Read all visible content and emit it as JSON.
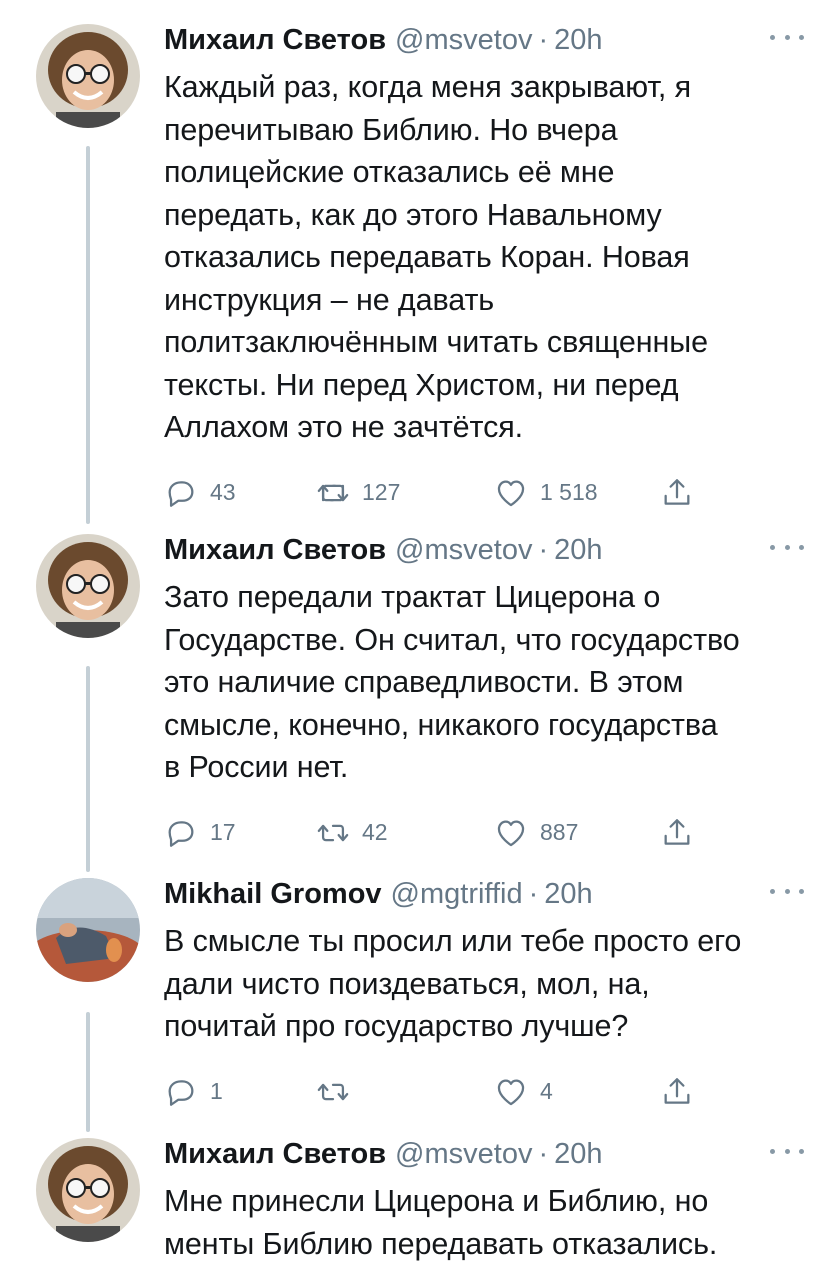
{
  "tweets": [
    {
      "name": "Михаил Светов",
      "handle": "@msvetov",
      "separator": "·",
      "time": "20h",
      "text": "Каждый раз, когда меня закрывают, я\nперечитываю Библию. Но вчера\nполицейские отказались её мне\nпередать, как до этого Навальному\nотказались передавать Коран. Новая\nинструкция – не давать\nполитзаключённым читать священные\nтексты. Ни перед Христом, ни перед\nАллахом это не зачтётся.",
      "replies": "43",
      "retweets": "127",
      "likes": "1 518"
    },
    {
      "name": "Михаил Светов",
      "handle": "@msvetov",
      "separator": "·",
      "time": "20h",
      "text": "Зато передали трактат Цицерона о\nГосударстве. Он считал, что государство\nэто наличие справедливости. В этом\nсмысле, конечно, никакого государства\nв России нет.",
      "replies": "17",
      "retweets": "42",
      "likes": "887"
    },
    {
      "name": "Mikhail Gromov",
      "handle": "@mgtriffid",
      "separator": "·",
      "time": "20h",
      "text": "В смысле ты просил или тебе просто его\nдали чисто поиздеваться, мол, на,\nпочитай про государство лучше?",
      "replies": "1",
      "retweets": "",
      "likes": "4"
    },
    {
      "name": "Михаил Светов",
      "handle": "@msvetov",
      "separator": "·",
      "time": "20h",
      "text": "Мне принесли Цицерона и Библию, но\nменты Библию передавать отказались."
    }
  ],
  "icons": {
    "reply": "reply-icon",
    "retweet": "retweet-icon",
    "like": "heart-icon",
    "share": "share-icon",
    "more": "more-icon"
  },
  "colors": {
    "text": "#14171a",
    "secondary": "#657786",
    "thread_line": "#c4cfd6"
  }
}
